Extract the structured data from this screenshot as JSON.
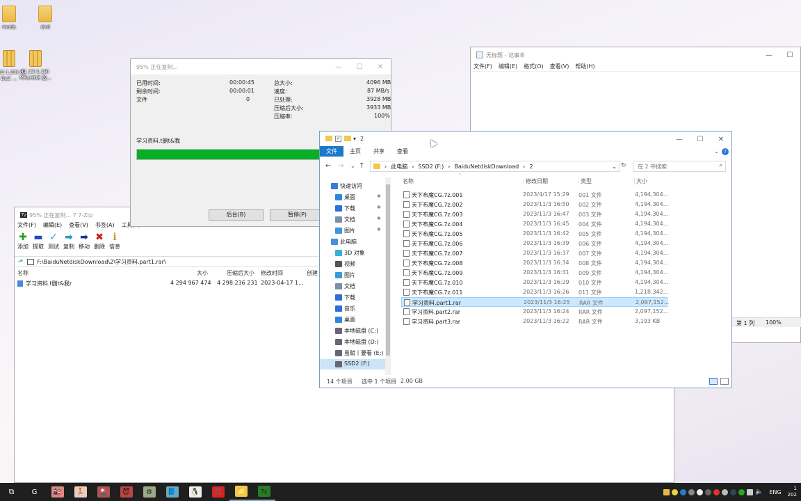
{
  "desktop": {
    "icons": [
      {
        "label": "mods",
        "type": "folder"
      },
      {
        "label": "dxd",
        "type": "folder"
      },
      {
        "label": "1.13 1.20) 改DLC ...",
        "type": "zip"
      },
      {
        "label": "(1.13-1.19) MRLHDE 版...",
        "type": "zip"
      }
    ]
  },
  "copy_dialog": {
    "title": "95% 正在复制...",
    "elapsed_label": "已用时间:",
    "elapsed": "00:00:45",
    "remaining_label": "剩余时间:",
    "remaining": "00:00:01",
    "files_label": "文件",
    "files": "0",
    "total_label": "总大小:",
    "total": "4096 MB",
    "speed_label": "速度:",
    "speed": "87 MB/s",
    "processed_label": "已处理:",
    "processed": "3928 MB",
    "compressed_label": "压缩后大小:",
    "compressed": "3933 MB",
    "ratio_label": "压缩率:",
    "ratio": "100%",
    "current_file": "学习资料.t删t&我",
    "progress": 0.95,
    "background_button": "后台(B)",
    "pause_button": "暂停(P)"
  },
  "notepad": {
    "title": "无标题 - 记事本",
    "menu": [
      "文件(F)",
      "编辑(E)",
      "格式(O)",
      "查看(V)",
      "帮助(H)"
    ],
    "status_line": "第 1 列",
    "status_zoom": "100%"
  },
  "sevenzip": {
    "title": "95% 正在复制... 7 7-Zip",
    "menu": [
      "文件(F)",
      "编辑(E)",
      "查看(V)",
      "书签(A)",
      "工具(T)"
    ],
    "toolbar": [
      {
        "label": "添加",
        "glyph": "✚",
        "color": "#1ea51e"
      },
      {
        "label": "提取",
        "glyph": "▬",
        "color": "#1e48c8"
      },
      {
        "label": "测试",
        "glyph": "✓",
        "color": "#1eaad2"
      },
      {
        "label": "复制",
        "glyph": "➡",
        "color": "#1e9ec8"
      },
      {
        "label": "移动",
        "glyph": "➡",
        "color": "#1e2f96"
      },
      {
        "label": "删除",
        "glyph": "✖",
        "color": "#d21e1e"
      },
      {
        "label": "信息",
        "glyph": "ℹ",
        "color": "#c8a01e"
      }
    ],
    "path": "F:\\BaiduNetdiskDownload\\2\\学习资料.part1.rar\\",
    "columns": [
      "名称",
      "大小",
      "压缩后大小",
      "修改时间",
      "创建"
    ],
    "rows": [
      {
        "name": "学习资料.t删t&我r",
        "size": "4 294 967 474",
        "packed": "4 298 236 231",
        "modified": "2023-04-17 1..."
      }
    ]
  },
  "explorer": {
    "title": "2",
    "ribbon_tabs": [
      "文件",
      "主页",
      "共享",
      "查看"
    ],
    "breadcrumb": [
      "此电脑",
      "SSD2 (F:)",
      "BaiduNetdiskDownload",
      "2"
    ],
    "search_placeholder": "在 2 中搜索",
    "nav": [
      {
        "label": "快速访问",
        "pin": false,
        "indent": 0,
        "color": "#3a7bd5",
        "sel": false
      },
      {
        "label": "桌面",
        "pin": true,
        "indent": 1,
        "color": "#2d89d8",
        "sel": false
      },
      {
        "label": "下载",
        "pin": true,
        "indent": 1,
        "color": "#2d6fd8",
        "sel": false
      },
      {
        "label": "文档",
        "pin": true,
        "indent": 1,
        "color": "#7a8fa8",
        "sel": false
      },
      {
        "label": "图片",
        "pin": true,
        "indent": 1,
        "color": "#3a9ad8",
        "sel": false
      },
      {
        "label": "此电脑",
        "pin": false,
        "indent": 0,
        "color": "#4a90d8",
        "sel": false
      },
      {
        "label": "3D 对象",
        "pin": false,
        "indent": 1,
        "color": "#3ab0d8",
        "sel": false
      },
      {
        "label": "视频",
        "pin": false,
        "indent": 1,
        "color": "#555",
        "sel": false
      },
      {
        "label": "图片",
        "pin": false,
        "indent": 1,
        "color": "#3a9ad8",
        "sel": false
      },
      {
        "label": "文档",
        "pin": false,
        "indent": 1,
        "color": "#7a8fa8",
        "sel": false
      },
      {
        "label": "下载",
        "pin": false,
        "indent": 1,
        "color": "#2d6fd8",
        "sel": false
      },
      {
        "label": "音乐",
        "pin": false,
        "indent": 1,
        "color": "#2d6fd8",
        "sel": false
      },
      {
        "label": "桌面",
        "pin": false,
        "indent": 1,
        "color": "#2d89d8",
        "sel": false
      },
      {
        "label": "本地磁盘 (C:)",
        "pin": false,
        "indent": 1,
        "color": "#667",
        "sel": false
      },
      {
        "label": "本地磁盘 (D:)",
        "pin": false,
        "indent": 1,
        "color": "#667",
        "sel": false
      },
      {
        "label": "虽赋丨要看 (E:)",
        "pin": false,
        "indent": 1,
        "color": "#667",
        "sel": false
      },
      {
        "label": "SSD2 (F:)",
        "pin": false,
        "indent": 1,
        "color": "#667",
        "sel": true
      }
    ],
    "columns": [
      "名称",
      "修改日期",
      "类型",
      "大小"
    ],
    "files": [
      {
        "name": "天下布魔CG.7z.001",
        "date": "2023/4/17 15:29",
        "type": "001 文件",
        "size": "4,194,304..."
      },
      {
        "name": "天下布魔CG.7z.002",
        "date": "2023/11/3 16:50",
        "type": "002 文件",
        "size": "4,194,304..."
      },
      {
        "name": "天下布魔CG.7z.003",
        "date": "2023/11/3 16:47",
        "type": "003 文件",
        "size": "4,194,304..."
      },
      {
        "name": "天下布魔CG.7z.004",
        "date": "2023/11/3 16:45",
        "type": "004 文件",
        "size": "4,194,304..."
      },
      {
        "name": "天下布魔CG.7z.005",
        "date": "2023/11/3 16:42",
        "type": "005 文件",
        "size": "4,194,304..."
      },
      {
        "name": "天下布魔CG.7z.006",
        "date": "2023/11/3 16:39",
        "type": "006 文件",
        "size": "4,194,304..."
      },
      {
        "name": "天下布魔CG.7z.007",
        "date": "2023/11/3 16:37",
        "type": "007 文件",
        "size": "4,194,304..."
      },
      {
        "name": "天下布魔CG.7z.008",
        "date": "2023/11/3 16:34",
        "type": "008 文件",
        "size": "4,194,304..."
      },
      {
        "name": "天下布魔CG.7z.009",
        "date": "2023/11/3 16:31",
        "type": "009 文件",
        "size": "4,194,304..."
      },
      {
        "name": "天下布魔CG.7z.010",
        "date": "2023/11/3 16:29",
        "type": "010 文件",
        "size": "4,194,304..."
      },
      {
        "name": "天下布魔CG.7z.011",
        "date": "2023/11/3 16:26",
        "type": "011 文件",
        "size": "1,218,342..."
      },
      {
        "name": "学习资料.part1.rar",
        "date": "2023/11/3 16:25",
        "type": "RAR 文件",
        "size": "2,097,152...",
        "selected": true,
        "rar": true
      },
      {
        "name": "学习资料.part2.rar",
        "date": "2023/11/3 16:24",
        "type": "RAR 文件",
        "size": "2,097,152...",
        "rar": true
      },
      {
        "name": "学习资料.part3.rar",
        "date": "2023/11/3 16:22",
        "type": "RAR 文件",
        "size": "3,193 KB",
        "rar": true
      }
    ],
    "status_count": "14 个项目",
    "status_selected": "选中 1 个项目",
    "status_size": "2.00 GB"
  },
  "taskbar": {
    "apps": [
      "G",
      "🎎",
      "🏃",
      "🎴",
      "😈",
      "⚙",
      "📘",
      "🐧",
      "🎵",
      "📁",
      "7z"
    ],
    "lang": "ENG",
    "clock": "1",
    "date": "202"
  }
}
